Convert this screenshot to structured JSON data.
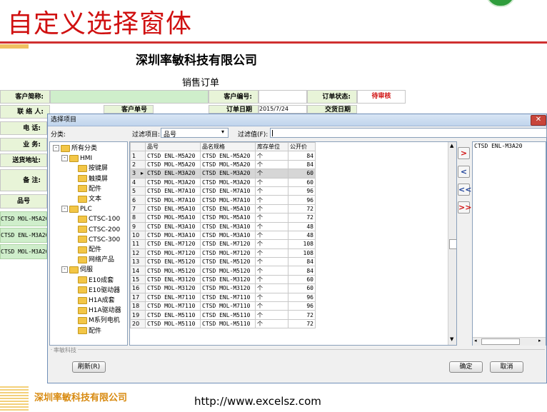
{
  "slide": {
    "title": "自定义选择窗体",
    "company_heading": "深圳率敏科技有限公司",
    "order_heading": "销售订单",
    "footer_company": "深圳率敏科技有限公司",
    "footer_url": "http://www.excelsz.com"
  },
  "sheet": {
    "labels": {
      "customer_name": "客户简称:",
      "contact": "联 络 人:",
      "phone": "电    话:",
      "salesperson": "业    务:",
      "delivery_address": "送货地址:",
      "remarks": "备    注:",
      "customer_no": "客户编号:",
      "order_status": "订单状态:",
      "order_no_partial": "客户单号",
      "order_date_partial": "订单日期",
      "order_date_value": "2015/7/24",
      "delivery_date_partial": "交货日期",
      "part_no_header": "品号"
    },
    "order_status_value": "待审核",
    "product_rows": [
      "CTSD MOL-M5A20",
      "CTSD ENL-M3A20",
      "CTSD MOL-M3A20"
    ]
  },
  "dialog": {
    "title": "选择项目",
    "category_label": "分类:",
    "filter_item_label": "过滤项目:",
    "filter_item_value": "品号",
    "filter_value_label": "过滤值(F):",
    "filter_value": "",
    "group_caption": "率敏科技",
    "refresh_label": "刷新(R)",
    "ok_label": "确定",
    "cancel_label": "取消",
    "arrows": {
      "add_one": ">",
      "remove_one": "<",
      "remove_all": "<<",
      "add_all": ">>"
    },
    "selected_items": [
      "CTSD ENL-M3A20"
    ],
    "tree": [
      {
        "label": "所有分类",
        "level": 0,
        "expander": "-"
      },
      {
        "label": "HMI",
        "level": 1,
        "expander": "-"
      },
      {
        "label": "按键屏",
        "level": 2
      },
      {
        "label": "触摸屏",
        "level": 2
      },
      {
        "label": "配件",
        "level": 2
      },
      {
        "label": "文本",
        "level": 2
      },
      {
        "label": "PLC",
        "level": 1,
        "expander": "-"
      },
      {
        "label": "CTSC-100",
        "level": 2
      },
      {
        "label": "CTSC-200",
        "level": 2
      },
      {
        "label": "CTSC-300",
        "level": 2
      },
      {
        "label": "配件",
        "level": 2
      },
      {
        "label": "网络产品",
        "level": 2
      },
      {
        "label": "伺服",
        "level": 1,
        "expander": "-"
      },
      {
        "label": "E10成套",
        "level": 2
      },
      {
        "label": "E10驱动器",
        "level": 2
      },
      {
        "label": "H1A成套",
        "level": 2
      },
      {
        "label": "H1A驱动器",
        "level": 2
      },
      {
        "label": "M系列电机",
        "level": 2
      },
      {
        "label": "配件",
        "level": 2
      }
    ],
    "grid": {
      "headers": [
        "品号",
        "品名规格",
        "库存单位",
        "公开价"
      ],
      "selected_row": 3,
      "rows": [
        [
          "1",
          "CTSD ENL-M5A20",
          "CTSD ENL-M5A20",
          "个",
          "84"
        ],
        [
          "2",
          "CTSD MOL-M5A20",
          "CTSD MOL-M5A20",
          "个",
          "84"
        ],
        [
          "3",
          "CTSD ENL-M3A20",
          "CTSD ENL-M3A20",
          "个",
          "60"
        ],
        [
          "4",
          "CTSD MOL-M3A20",
          "CTSD MOL-M3A20",
          "个",
          "60"
        ],
        [
          "5",
          "CTSD ENL-M7A10",
          "CTSD ENL-M7A10",
          "个",
          "96"
        ],
        [
          "6",
          "CTSD MOL-M7A10",
          "CTSD MOL-M7A10",
          "个",
          "96"
        ],
        [
          "7",
          "CTSD ENL-M5A10",
          "CTSD ENL-M5A10",
          "个",
          "72"
        ],
        [
          "8",
          "CTSD MOL-M5A10",
          "CTSD MOL-M5A10",
          "个",
          "72"
        ],
        [
          "9",
          "CTSD ENL-M3A10",
          "CTSD ENL-M3A10",
          "个",
          "48"
        ],
        [
          "10",
          "CTSD MOL-M3A10",
          "CTSD MOL-M3A10",
          "个",
          "48"
        ],
        [
          "11",
          "CTSD ENL-M7120",
          "CTSD ENL-M7120",
          "个",
          "108"
        ],
        [
          "12",
          "CTSD MOL-M7120",
          "CTSD MOL-M7120",
          "个",
          "108"
        ],
        [
          "13",
          "CTSD ENL-M5120",
          "CTSD ENL-M5120",
          "个",
          "84"
        ],
        [
          "14",
          "CTSD MOL-M5120",
          "CTSD MOL-M5120",
          "个",
          "84"
        ],
        [
          "15",
          "CTSD ENL-M3120",
          "CTSD ENL-M3120",
          "个",
          "60"
        ],
        [
          "16",
          "CTSD MOL-M3120",
          "CTSD MOL-M3120",
          "个",
          "60"
        ],
        [
          "17",
          "CTSD ENL-M7110",
          "CTSD ENL-M7110",
          "个",
          "96"
        ],
        [
          "18",
          "CTSD MOL-M7110",
          "CTSD MOL-M7110",
          "个",
          "96"
        ],
        [
          "19",
          "CTSD ENL-M5110",
          "CTSD ENL-M5110",
          "个",
          "72"
        ],
        [
          "20",
          "CTSD MOL-M5110",
          "CTSD MOL-M5110",
          "个",
          "72"
        ]
      ]
    }
  }
}
